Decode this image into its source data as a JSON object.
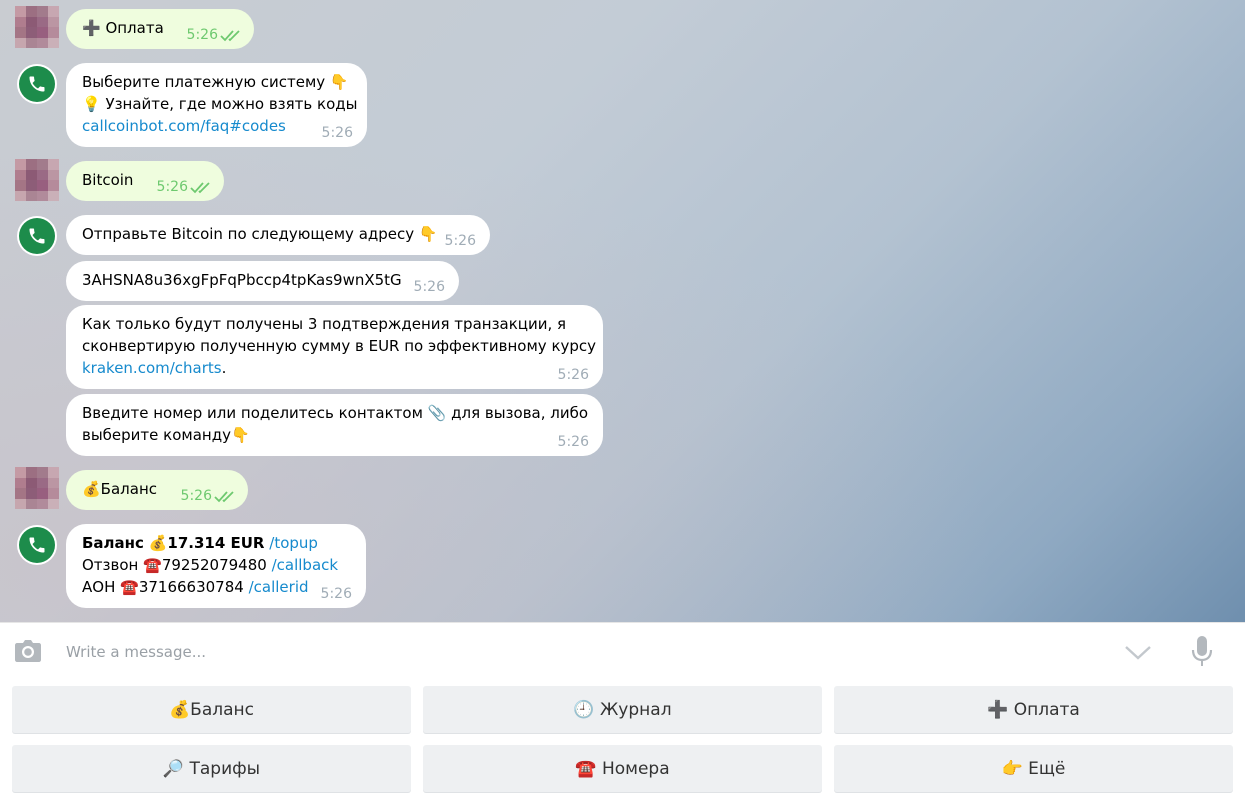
{
  "messages": [
    {
      "sender": "user",
      "text": "➕ Оплата",
      "time": "5:26"
    },
    {
      "sender": "bot",
      "lines": [
        "Выберите платежную систему 👇",
        "💡 Узнайте, где можно взять коды"
      ],
      "link": "callcoinbot.com/faq#codes",
      "time": "5:26"
    },
    {
      "sender": "user",
      "text": "Bitcoin",
      "time": "5:26"
    },
    {
      "sender": "bot",
      "text": "Отправьте Bitcoin по следующему адресу 👇",
      "time": "5:26"
    },
    {
      "sender": "bot",
      "text": "3AHSNA8u36xgFpFqPbccp4tpKas9wnX5tG",
      "time": "5:26"
    },
    {
      "sender": "bot",
      "lines": [
        "Как только будут получены 3 подтверждения транзакции, я",
        "сконвертирую полученную сумму в EUR по эффективному курсу"
      ],
      "link": "kraken.com/charts",
      "after_link": ".",
      "time": "5:26"
    },
    {
      "sender": "bot",
      "lines": [
        "Введите номер или поделитесь контактом 📎 для вызова, либо",
        "выберите команду👇"
      ],
      "time": "5:26"
    },
    {
      "sender": "user",
      "text": "💰Баланс",
      "time": "5:26"
    },
    {
      "sender": "bot",
      "balance": {
        "label": "Баланс",
        "icon": "💰",
        "amount": "17.314 EUR",
        "cmd": "/topup",
        "callback_label": "Отзвон",
        "callback_icon": "☎️",
        "callback_number": "79252079480",
        "callback_cmd": "/callback",
        "aon_label": "АОН",
        "aon_icon": "☎️",
        "aon_number": "37166630784",
        "aon_cmd": "/callerid"
      },
      "time": "5:26"
    }
  ],
  "composer": {
    "placeholder": "Write a message..."
  },
  "keyboard": [
    {
      "label": "💰Баланс"
    },
    {
      "label": "🕘 Журнал"
    },
    {
      "label": "➕ Оплата"
    },
    {
      "label": "🔎 Тарифы"
    },
    {
      "label": "☎️ Номера"
    },
    {
      "label": "👉 Ещё"
    }
  ],
  "colors": {
    "bot_avatar": "#1d8c4b",
    "link": "#168acd",
    "out_bubble": "#effdde",
    "checks": "#6ec96f"
  }
}
